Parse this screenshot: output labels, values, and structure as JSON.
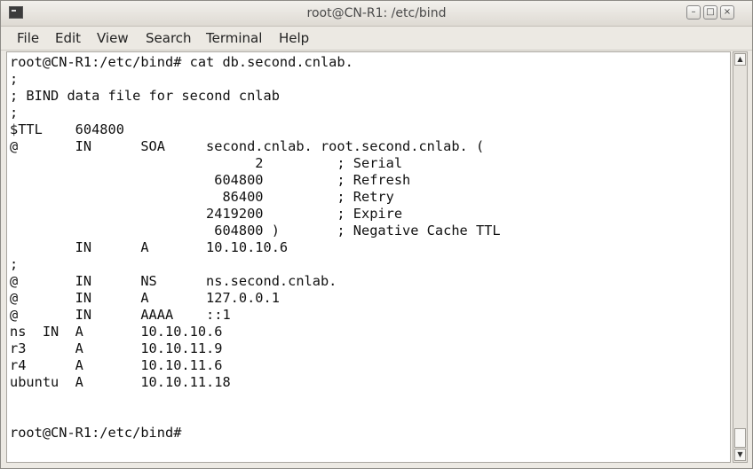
{
  "window": {
    "title": "root@CN-R1: /etc/bind",
    "minimize": "–",
    "maximize": "□",
    "close": "×"
  },
  "menubar": {
    "items": [
      "File",
      "Edit",
      "View",
      "Search",
      "Terminal",
      "Help"
    ]
  },
  "terminal": {
    "lines": [
      "root@CN-R1:/etc/bind# cat db.second.cnlab.",
      ";",
      "; BIND data file for second cnlab",
      ";",
      "$TTL    604800",
      "@       IN      SOA     second.cnlab. root.second.cnlab. (",
      "                              2         ; Serial",
      "                         604800         ; Refresh",
      "                          86400         ; Retry",
      "                        2419200         ; Expire",
      "                         604800 )       ; Negative Cache TTL",
      "        IN      A       10.10.10.6",
      ";",
      "@       IN      NS      ns.second.cnlab.",
      "@       IN      A       127.0.0.1",
      "@       IN      AAAA    ::1",
      "ns  IN  A       10.10.10.6",
      "r3      A       10.10.11.9",
      "r4      A       10.10.11.6",
      "ubuntu  A       10.10.11.18",
      "",
      "",
      "root@CN-R1:/etc/bind#"
    ]
  },
  "scrollbar": {
    "up_arrow": "▲",
    "down_arrow": "▼"
  }
}
